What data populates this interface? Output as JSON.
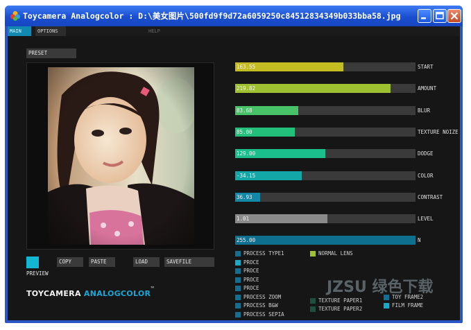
{
  "window": {
    "title": "Toycamera Analogcolor : D:\\美女图片\\500fd9f9d72a6059250c84512834349b033bba58.jpg"
  },
  "menu": {
    "main": "MAIN",
    "options": "OPTIONS",
    "help": "HELP"
  },
  "preset": {
    "label": "PRESET"
  },
  "buttons": {
    "preview": "PREVIEW",
    "copy": "COPY",
    "paste": "PASTE",
    "load": "LOAD",
    "savefile": "SAVEFILE"
  },
  "sliders": [
    {
      "label": "START",
      "value": "163.55",
      "level": 0.6,
      "color": "#c4bd22"
    },
    {
      "label": "AMOUNT",
      "value": "219.82",
      "level": 0.86,
      "color": "#9fc030"
    },
    {
      "label": "BLUR",
      "value": "83.68",
      "level": 0.35,
      "color": "#47c266"
    },
    {
      "label": "TEXTURE NOIZE",
      "value": "85.00",
      "level": 0.33,
      "color": "#22c07a"
    },
    {
      "label": "DODGE",
      "value": "129.00",
      "level": 0.5,
      "color": "#1bbf8c"
    },
    {
      "label": "COLOR",
      "value": "-34.15",
      "level": 0.37,
      "color": "#14a7a8"
    },
    {
      "label": "CONTRAST",
      "value": "36.93",
      "level": 0.14,
      "color": "#1388a6"
    },
    {
      "label": "LEVEL",
      "value": "1.01",
      "level": 0.51,
      "color": "#8a8a8a"
    },
    {
      "label": "N",
      "value": "255.00",
      "level": 1.0,
      "color": "#0f6f8f"
    }
  ],
  "options_left": [
    {
      "label": "PROCESS TYPE1",
      "color": "#136f91"
    },
    {
      "label": "PROCE",
      "color": "#17a9c6"
    },
    {
      "label": "PROCE",
      "color": "#136f91"
    },
    {
      "label": "PROCE",
      "color": "#136f91"
    },
    {
      "label": "PROCE",
      "color": "#136f91"
    },
    {
      "label": "PROCESS ZOOM",
      "color": "#136f91"
    },
    {
      "label": "PROCESS B&W",
      "color": "#136f91"
    },
    {
      "label": "PROCESS SEPIA",
      "color": "#136f91"
    }
  ],
  "options_mid": [
    {
      "label": "NORMAL LENS",
      "color": "#9fc030"
    },
    {
      "label": "TEXTURE PAPER1",
      "color": "#1c4f3c"
    },
    {
      "label": "TEXTURE PAPER2",
      "color": "#1c4f3c"
    }
  ],
  "options_right": [
    {
      "label": "TOY FRAME2",
      "color": "#136f91"
    },
    {
      "label": "FILM FRAME",
      "color": "#17a9c6"
    }
  ],
  "logo": {
    "part1": "TOYCAMERA ",
    "part2": "ANALOGCOLOR",
    "tm": "™"
  },
  "watermark": "JZSU 绿色下载"
}
